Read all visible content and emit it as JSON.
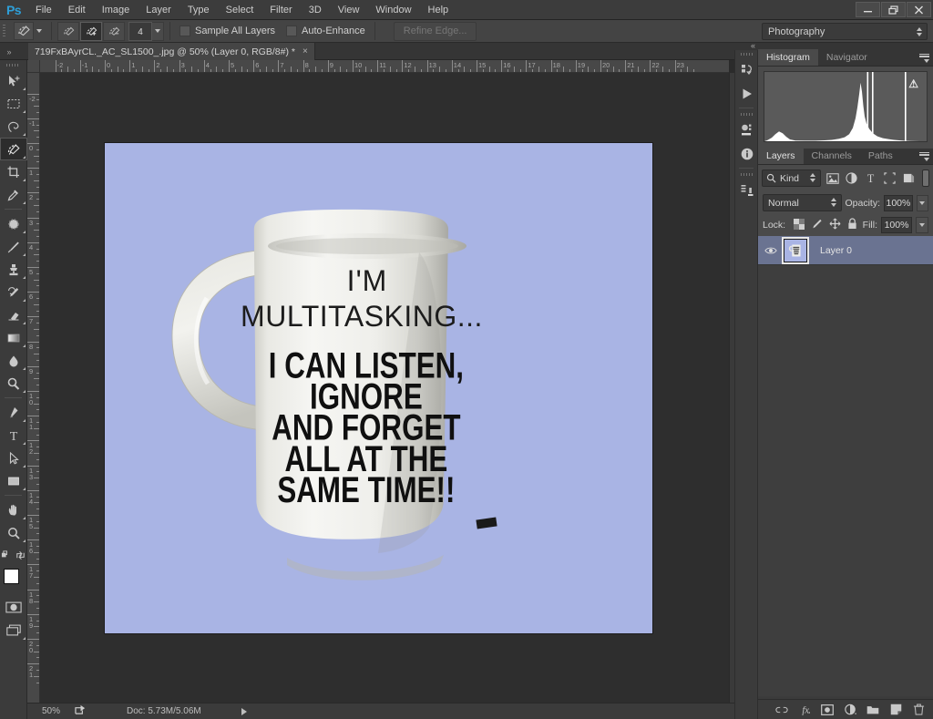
{
  "app": {
    "logo": "Ps",
    "menus": [
      "File",
      "Edit",
      "Image",
      "Layer",
      "Type",
      "Select",
      "Filter",
      "3D",
      "View",
      "Window",
      "Help"
    ],
    "window_controls": [
      "minimize",
      "restore",
      "close"
    ]
  },
  "options_bar": {
    "tool_preset_name": "quick-selection-tool",
    "modes": [
      "new-selection",
      "add-to-selection",
      "subtract-from-selection"
    ],
    "active_mode_index": 1,
    "brush_size": "4",
    "sample_all_layers_label": "Sample All Layers",
    "sample_all_layers_checked": false,
    "auto_enhance_label": "Auto-Enhance",
    "auto_enhance_checked": false,
    "refine_edge_label": "Refine Edge...",
    "refine_edge_enabled": false,
    "workspace": "Photography"
  },
  "document": {
    "tab_title": "719FxBAyrCL._AC_SL1500_.jpg @ 50% (Layer 0, RGB/8#) *",
    "close_glyph": "×"
  },
  "toolbar": {
    "tools": [
      {
        "name": "move-tool",
        "has_flyout": true
      },
      {
        "name": "rectangular-marquee-tool",
        "has_flyout": true
      },
      {
        "name": "lasso-tool",
        "has_flyout": true
      },
      {
        "name": "quick-selection-tool",
        "has_flyout": true,
        "active": true
      },
      {
        "name": "crop-tool",
        "has_flyout": true
      },
      {
        "name": "eyedropper-tool",
        "has_flyout": true
      },
      {
        "name": "spot-healing-brush-tool",
        "has_flyout": true
      },
      {
        "name": "brush-tool",
        "has_flyout": true
      },
      {
        "name": "clone-stamp-tool",
        "has_flyout": true
      },
      {
        "name": "history-brush-tool",
        "has_flyout": true
      },
      {
        "name": "eraser-tool",
        "has_flyout": true
      },
      {
        "name": "gradient-tool",
        "has_flyout": true
      },
      {
        "name": "blur-tool",
        "has_flyout": true
      },
      {
        "name": "dodge-tool",
        "has_flyout": true
      },
      {
        "name": "pen-tool",
        "has_flyout": true
      },
      {
        "name": "horizontal-type-tool",
        "has_flyout": true
      },
      {
        "name": "path-selection-tool",
        "has_flyout": true
      },
      {
        "name": "rectangle-tool",
        "has_flyout": true
      },
      {
        "name": "hand-tool",
        "has_flyout": true
      },
      {
        "name": "zoom-tool",
        "has_flyout": true
      }
    ],
    "foreground_color": "#ffffff",
    "background_color": "#c9b89c",
    "quick_mask_name": "edit-in-quick-mask-mode",
    "screen_mode_name": "change-screen-mode"
  },
  "rulers": {
    "unit": "inches",
    "horizontal_labels": [
      "-2",
      "-1",
      "0",
      "1",
      "2",
      "3",
      "4",
      "5",
      "6",
      "7",
      "8",
      "9",
      "10",
      "11",
      "12",
      "13",
      "14",
      "15",
      "16",
      "17",
      "18",
      "19",
      "20",
      "21",
      "22",
      "23"
    ],
    "vertical_labels": [
      "-2",
      "-1",
      "0",
      "1",
      "2",
      "3",
      "4",
      "5",
      "6",
      "7",
      "8",
      "9",
      "10",
      "11",
      "12",
      "13",
      "14",
      "15",
      "16",
      "17",
      "18",
      "19",
      "20",
      "21"
    ]
  },
  "canvas": {
    "background_color": "#a9b4e4",
    "image_alt": "white coffee mug with slogan text",
    "mug_text": {
      "line1": "I'M",
      "line2": "MULTITASKING...",
      "line3": "I CAN LISTEN,",
      "line4": "IGNORE",
      "line5": "AND FORGET",
      "line6": "ALL AT THE",
      "line7": "SAME TIME!!"
    }
  },
  "status_bar": {
    "zoom": "50%",
    "doc_info": "Doc: 5.73M/5.06M"
  },
  "mini_dock": {
    "icons": [
      "history-panel-icon",
      "actions-play-icon",
      "adjustments-panel-icon",
      "info-panel-icon",
      "mini-bridge-icon"
    ]
  },
  "histogram_panel": {
    "tabs": [
      {
        "label": "Histogram",
        "active": true
      },
      {
        "label": "Navigator",
        "active": false
      }
    ],
    "warning_glyph": "⚠",
    "menu_name": "panel-menu-icon"
  },
  "layers_panel": {
    "tabs": [
      {
        "label": "Layers",
        "active": true
      },
      {
        "label": "Channels",
        "active": false
      },
      {
        "label": "Paths",
        "active": false
      }
    ],
    "filter_kind_label": "Kind",
    "filter_icons": [
      "filter-pixel-icon",
      "filter-adjustment-icon",
      "filter-type-icon",
      "filter-shape-icon",
      "filter-smart-object-icon"
    ],
    "blend_mode": "Normal",
    "opacity_label": "Opacity:",
    "opacity_value": "100%",
    "lock_label": "Lock:",
    "lock_icons": [
      "lock-transparent-pixels-icon",
      "lock-image-pixels-icon",
      "lock-position-icon",
      "lock-all-icon"
    ],
    "fill_label": "Fill:",
    "fill_value": "100%",
    "layers": [
      {
        "name": "Layer 0",
        "visible": true,
        "selected": true
      }
    ],
    "footer_icons": [
      "link-layers-icon",
      "add-layer-style-icon",
      "add-layer-mask-icon",
      "new-adjustment-layer-icon",
      "new-group-icon",
      "new-layer-icon",
      "delete-layer-icon"
    ]
  }
}
